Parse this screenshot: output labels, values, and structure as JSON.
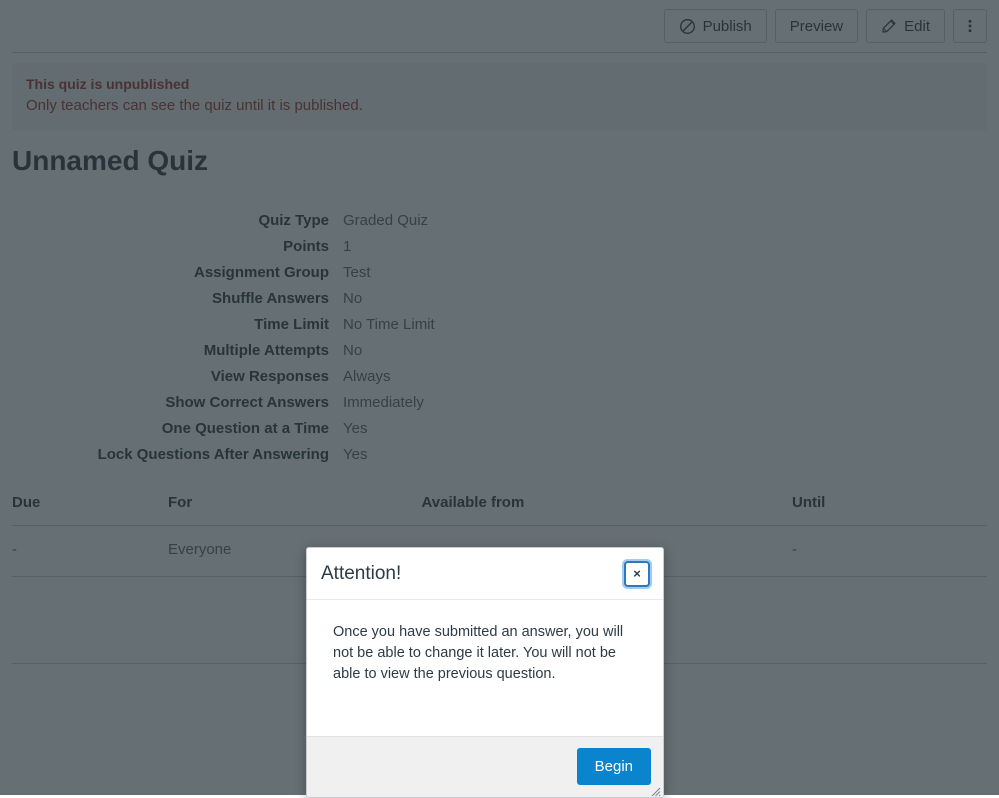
{
  "toolbar": {
    "publish_label": "Publish",
    "preview_label": "Preview",
    "edit_label": "Edit",
    "more_label": "",
    "publish_icon": "circle-slash-icon",
    "edit_icon": "pencil-icon",
    "more_icon": "kebab-menu-icon"
  },
  "alert": {
    "title": "This quiz is unpublished",
    "text": "Only teachers can see the quiz until it is published.",
    "color": "#a0332a"
  },
  "page": {
    "title": "Unnamed Quiz"
  },
  "details": [
    {
      "label": "Quiz Type",
      "value": "Graded Quiz"
    },
    {
      "label": "Points",
      "value": "1"
    },
    {
      "label": "Assignment Group",
      "value": "Test"
    },
    {
      "label": "Shuffle Answers",
      "value": "No"
    },
    {
      "label": "Time Limit",
      "value": "No Time Limit"
    },
    {
      "label": "Multiple Attempts",
      "value": "No"
    },
    {
      "label": "View Responses",
      "value": "Always"
    },
    {
      "label": "Show Correct Answers",
      "value": "Immediately"
    },
    {
      "label": "One Question at a Time",
      "value": "Yes"
    },
    {
      "label": "Lock Questions After Answering",
      "value": "Yes"
    }
  ],
  "dates_table": {
    "headers": [
      "Due",
      "For",
      "Available from",
      "Until"
    ],
    "rows": [
      {
        "due": "-",
        "for": "Everyone",
        "available_from": "-",
        "until": "-"
      }
    ]
  },
  "modal": {
    "title": "Attention!",
    "close_label": "×",
    "close_icon": "close-icon",
    "body": "Once you have submitted an answer, you will not be able to change it later. You will not be able to view the previous question.",
    "begin_label": "Begin",
    "accent_color": "#0a84cd",
    "resize_icon": "resize-grip-icon"
  }
}
